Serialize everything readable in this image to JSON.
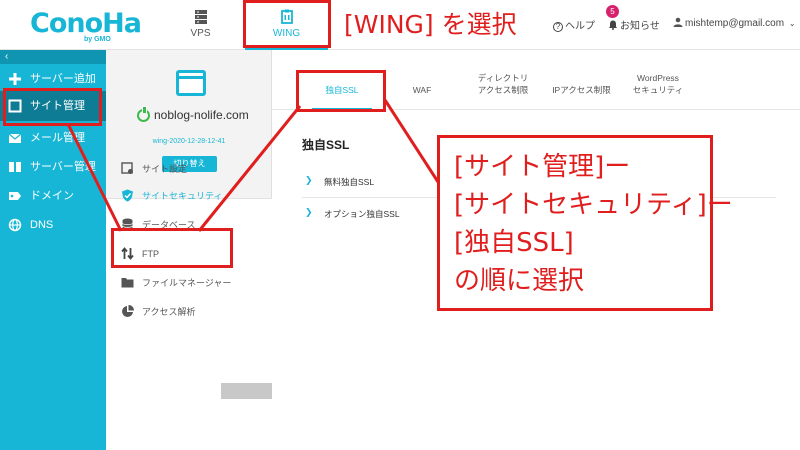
{
  "header": {
    "logo": {
      "text": "ConoHa",
      "sub": "by GMO"
    },
    "tabs": [
      {
        "label": "VPS",
        "icon": "server-icon"
      },
      {
        "label": "WING",
        "icon": "wing-icon"
      }
    ],
    "help_label": "ヘルプ",
    "notice_label": "お知らせ",
    "notice_count": "5",
    "account_label": "mishtemp@gmail.com"
  },
  "sidebar": {
    "collapse_glyph": "‹",
    "items": [
      {
        "label": "サーバー追加",
        "icon": "plus-icon"
      },
      {
        "label": "サイト管理",
        "icon": "site-window-icon"
      },
      {
        "label": "メール管理",
        "icon": "mail-icon"
      },
      {
        "label": "サーバー管理",
        "icon": "server-icon"
      },
      {
        "label": "ドメイン",
        "icon": "domain-icon"
      },
      {
        "label": "DNS",
        "icon": "globe-icon"
      }
    ]
  },
  "site_panel": {
    "domain": "noblog-nolife.com",
    "server_id": "wing-2020-12-28-12-41",
    "switch_label": "切り替え",
    "menu": [
      {
        "label": "サイト設定",
        "icon": "site-settings-icon"
      },
      {
        "label": "サイトセキュリティ",
        "icon": "shield-icon"
      },
      {
        "label": "データベース",
        "icon": "database-icon"
      },
      {
        "label": "FTP",
        "icon": "ftp-arrows-icon"
      },
      {
        "label": "ファイルマネージャー",
        "icon": "folder-icon"
      },
      {
        "label": "アクセス解析",
        "icon": "pie-chart-icon"
      }
    ]
  },
  "content": {
    "tabs": [
      {
        "line1": "独自SSL",
        "line2": ""
      },
      {
        "line1": "WAF",
        "line2": ""
      },
      {
        "line1": "ディレクトリ",
        "line2": "アクセス制限"
      },
      {
        "line1": "IPアクセス制限",
        "line2": ""
      },
      {
        "line1": "WordPress",
        "line2": "セキュリティ"
      }
    ],
    "section_title": "独自SSL",
    "rows": [
      {
        "label": "無料独自SSL"
      },
      {
        "label": "オプション独自SSL"
      }
    ]
  },
  "annotations": {
    "wing_label": "[WING] を選択",
    "callout_lines": [
      "[サイト管理]ー",
      "[サイトセキュリティ]ー",
      "[独自SSL]",
      "の順に選択"
    ]
  },
  "colors": {
    "accent": "#18b6d6",
    "sidebar_active": "#0e7c95",
    "annotation_red": "#e01e1e",
    "notice_badge": "#d6226c"
  }
}
